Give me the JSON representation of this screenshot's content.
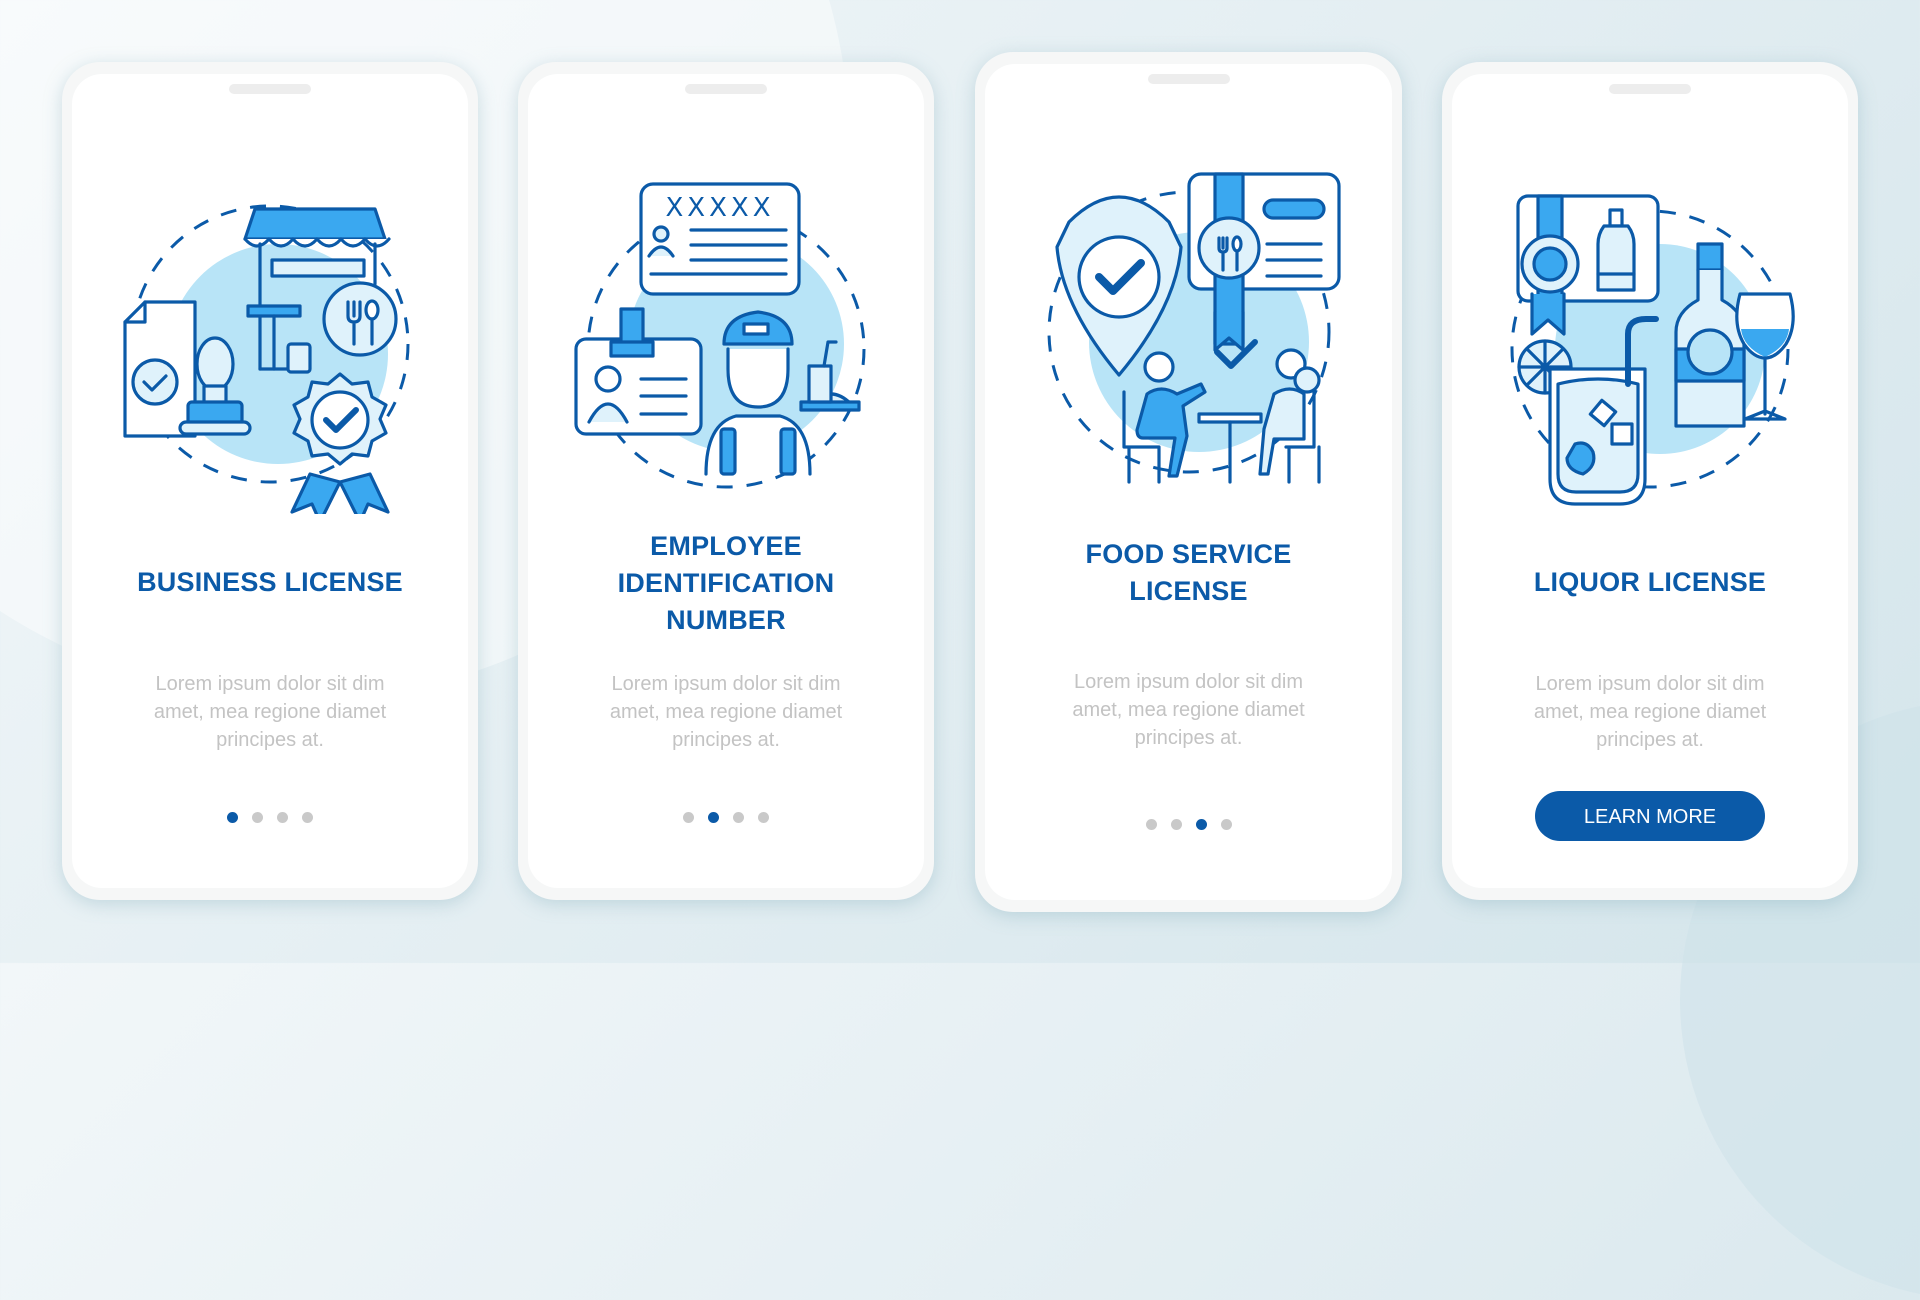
{
  "colors": {
    "brand_dark": "#0b5aa8",
    "brand_medium": "#3aa8f0",
    "brand_light": "#b8e4f7",
    "text_muted": "#c3c3c3",
    "dot_inactive": "#c9c9c9"
  },
  "screens": [
    {
      "illustration": "business-license-illustration",
      "title_lines": [
        "BUSINESS LICENSE"
      ],
      "description_lines": [
        "Lorem ipsum dolor sit dim",
        "amet, mea regione diamet",
        "principes at."
      ],
      "page_indicator": {
        "total": 4,
        "active_index": 0
      }
    },
    {
      "illustration": "employee-id-illustration",
      "title_lines": [
        "EMPLOYEE",
        "IDENTIFICATION",
        "NUMBER"
      ],
      "description_lines": [
        "Lorem ipsum dolor sit dim",
        "amet, mea regione diamet",
        "principes at."
      ],
      "page_indicator": {
        "total": 4,
        "active_index": 1
      },
      "id_card_text": "XXXXX"
    },
    {
      "illustration": "food-service-license-illustration",
      "title_lines": [
        "FOOD SERVICE",
        "LICENSE"
      ],
      "description_lines": [
        "Lorem ipsum dolor sit dim",
        "amet, mea regione diamet",
        "principes at."
      ],
      "page_indicator": {
        "total": 4,
        "active_index": 2
      }
    },
    {
      "illustration": "liquor-license-illustration",
      "title_lines": [
        "LIQUOR LICENSE"
      ],
      "description_lines": [
        "Lorem ipsum dolor sit dim",
        "amet, mea regione diamet",
        "principes at."
      ],
      "button_label": "LEARN MORE"
    }
  ]
}
